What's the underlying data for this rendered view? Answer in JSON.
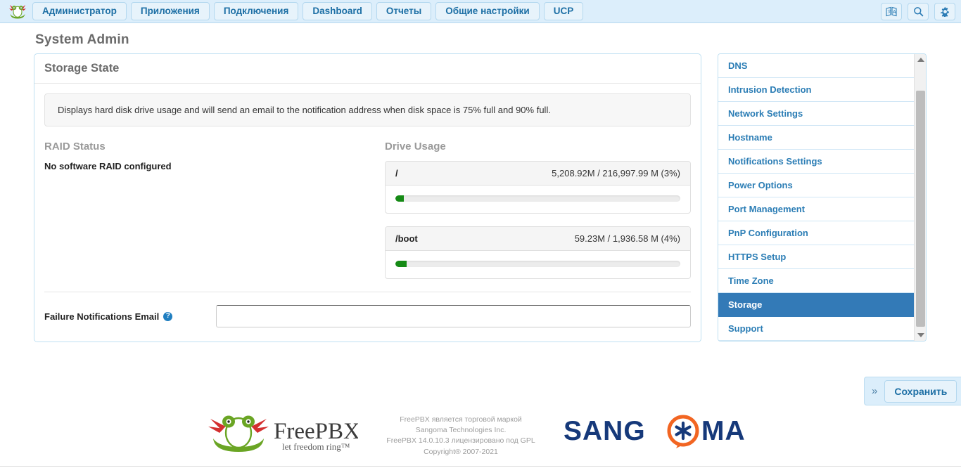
{
  "nav": {
    "logo_icon": "freepbx-frog-logo",
    "tabs": [
      {
        "label": "Администратор",
        "active": true
      },
      {
        "label": "Приложения",
        "active": false
      },
      {
        "label": "Подключения",
        "active": false
      },
      {
        "label": "Dashboard",
        "active": false
      },
      {
        "label": "Отчеты",
        "active": false
      },
      {
        "label": "Общие настройки",
        "active": false
      },
      {
        "label": "UCP",
        "active": false
      }
    ],
    "right_icons": [
      {
        "name": "language-icon"
      },
      {
        "name": "search-icon"
      },
      {
        "name": "gear-icon"
      }
    ]
  },
  "page": {
    "title": "System Admin"
  },
  "panel": {
    "title": "Storage State",
    "description": "Displays hard disk drive usage and will send an email to the notification address when disk space is 75% full and 90% full.",
    "raid": {
      "section_title": "RAID Status",
      "status_text": "No software RAID configured"
    },
    "drive_usage": {
      "section_title": "Drive Usage",
      "drives": [
        {
          "mount": "/",
          "usage_text": "5,208.92M / 216,997.99 M (3%)",
          "percent": 3
        },
        {
          "mount": "/boot",
          "usage_text": "59.23M / 1,936.58 M (4%)",
          "percent": 4
        }
      ]
    },
    "form": {
      "email_label": "Failure Notifications Email",
      "email_help_glyph": "?",
      "email_value": "",
      "email_placeholder": ""
    }
  },
  "sidebar": {
    "items": [
      {
        "label": "DNS",
        "active": false
      },
      {
        "label": "Intrusion Detection",
        "active": false
      },
      {
        "label": "Network Settings",
        "active": false
      },
      {
        "label": "Hostname",
        "active": false
      },
      {
        "label": "Notifications Settings",
        "active": false
      },
      {
        "label": "Power Options",
        "active": false
      },
      {
        "label": "Port Management",
        "active": false
      },
      {
        "label": "PnP Configuration",
        "active": false
      },
      {
        "label": "HTTPS Setup",
        "active": false
      },
      {
        "label": "Time Zone",
        "active": false
      },
      {
        "label": "Storage",
        "active": true
      },
      {
        "label": "Support",
        "active": false
      }
    ]
  },
  "actions": {
    "expand_glyph": "»",
    "save_label": "Сохранить"
  },
  "footer": {
    "freepbx_logo_text": "FreePBX",
    "freepbx_tagline": "let freedom ring™",
    "copyright_lines": [
      "FreePBX является торговой маркой",
      "Sangoma Technologies Inc.",
      "FreePBX 14.0.10.3 лицензировано под GPL",
      "Copyright® 2007-2021"
    ],
    "sangoma_logo_text": "SANGOMA"
  },
  "colors": {
    "accent_blue": "#337ab7",
    "nav_blue": "#dceefb",
    "link_blue": "#2b7db5",
    "progress_green": "#158a15",
    "sangoma_navy": "#16397a",
    "sangoma_orange": "#f26522"
  }
}
